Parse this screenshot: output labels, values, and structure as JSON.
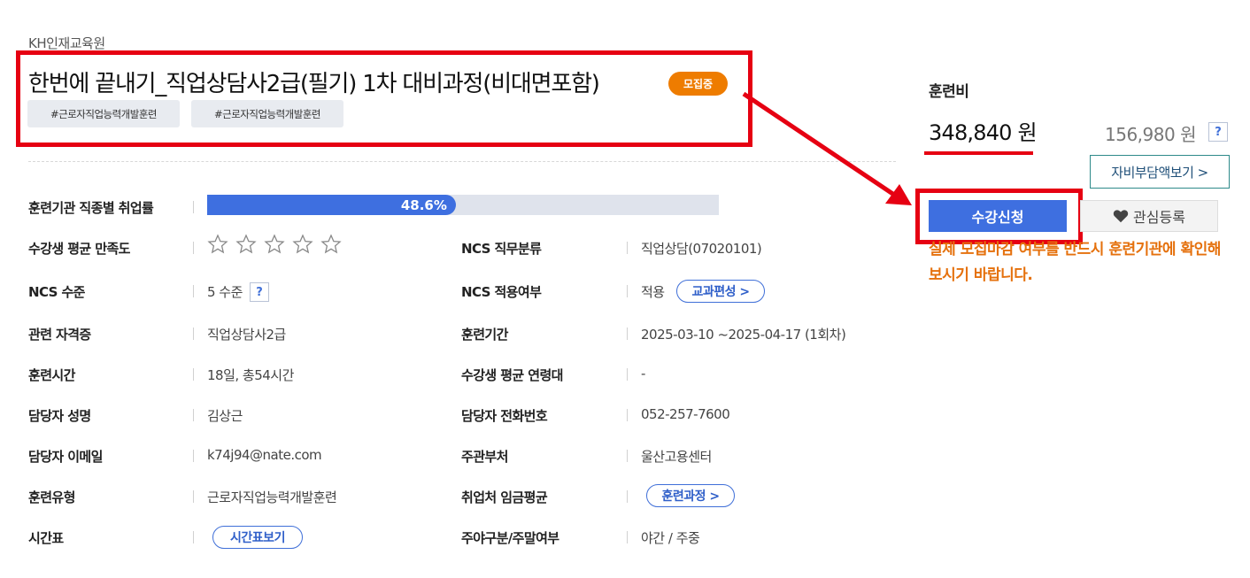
{
  "header": {
    "institute": "KH인재교육원",
    "title": "한번에 끝내기_직업상담사2급(필기) 1차 대비과정(비대면포함)",
    "status_badge": "모집중",
    "tags": [
      "#근로자직업능력개발훈련",
      "#근로자직업능력개발훈련"
    ]
  },
  "info": {
    "employment_rate": {
      "label": "훈련기관 직종별 취업률",
      "value_text": "48.6%",
      "value": 48.6
    },
    "satisfaction": {
      "label": "수강생 평균 만족도",
      "stars_total": 5,
      "stars_filled": 0
    },
    "ncs_category": {
      "label": "NCS 직무분류",
      "value": "직업상담(07020101)"
    },
    "ncs_level": {
      "label": "NCS 수준",
      "value": "5 수준",
      "help": "?"
    },
    "ncs_applied": {
      "label": "NCS 적용여부",
      "value": "적용",
      "button": "교과편성 >"
    },
    "certificate": {
      "label": "관련 자격증",
      "value": "직업상담사2급"
    },
    "period": {
      "label": "훈련기간",
      "value": "2025-03-10 ~2025-04-17 (1회차)"
    },
    "hours": {
      "label": "훈련시간",
      "value": "18일, 총54시간"
    },
    "age_group": {
      "label": "수강생 평균 연령대",
      "value": "-"
    },
    "manager": {
      "label": "담당자 성명",
      "value": "김상근"
    },
    "phone": {
      "label": "담당자 전화번호",
      "value": "052-257-7600"
    },
    "email": {
      "label": "담당자 이메일",
      "value": "k74j94@nate.com"
    },
    "agency": {
      "label": "주관부처",
      "value": "울산고용센터"
    },
    "training_type": {
      "label": "훈련유형",
      "value": "근로자직업능력개발훈련"
    },
    "wage": {
      "label": "취업처 임금평균",
      "button": "훈련과정 >"
    },
    "timetable": {
      "label": "시간표",
      "button": "시간표보기"
    },
    "day_night": {
      "label": "주야구분/주말여부",
      "value": "야간 / 주중"
    }
  },
  "sidebar": {
    "fee_label": "훈련비",
    "fee_price": "348,840 원",
    "fee_alt": "156,980 원",
    "help": "?",
    "self_pay_button": "자비부담액보기 >",
    "apply_button": "수강신청",
    "favorite_button": "관심등록",
    "notice": "실제 모집마감 여부를 반드시 훈련기관에 확인해보시기 바랍니다."
  },
  "colors": {
    "accent_blue": "#3e6fe0",
    "badge_orange": "#ee7c00",
    "annotation_red": "#e60012",
    "notice_orange": "#e5710d"
  }
}
